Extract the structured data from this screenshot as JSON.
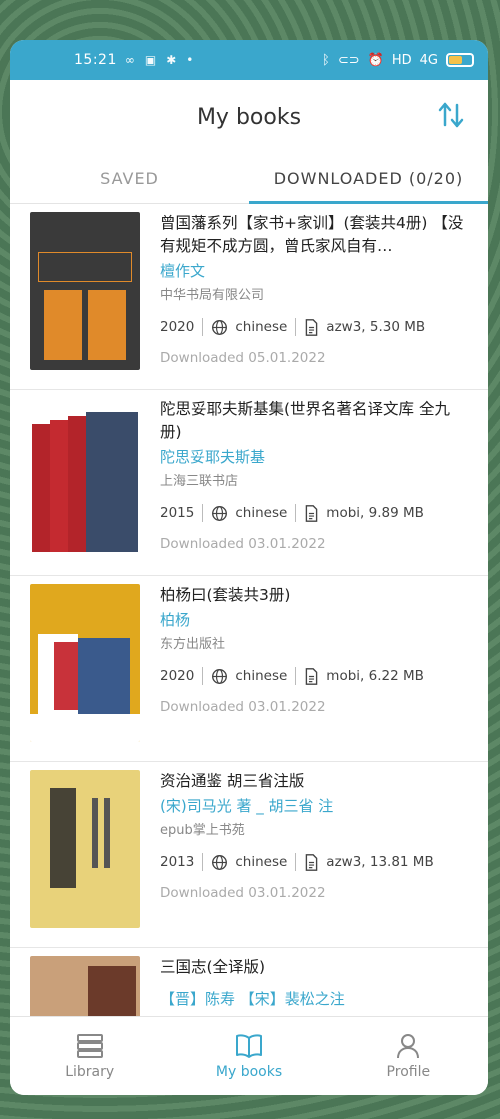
{
  "status": {
    "time": "15:21",
    "network": "4G"
  },
  "header": {
    "title": "My books"
  },
  "tabs": [
    {
      "label": "SAVED"
    },
    {
      "label": "DOWNLOADED (0/20)"
    }
  ],
  "books": [
    {
      "title": "曾国藩系列【家书+家训】(套装共4册) 【没有规矩不成方圆，曾氏家风自有…",
      "author": "檀作文",
      "publisher": "中华书局有限公司",
      "year": "2020",
      "language": "chinese",
      "file": "azw3, 5.30 MB",
      "downloaded": "Downloaded 05.01.2022",
      "cover_color": "#3a3a3a",
      "cover_accent": "#e08a2a"
    },
    {
      "title": "陀思妥耶夫斯基集(世界名著名译文库 全九册)",
      "author": "陀思妥耶夫斯基",
      "publisher": "上海三联书店",
      "year": "2015",
      "language": "chinese",
      "file": "mobi, 9.89 MB",
      "downloaded": "Downloaded 03.01.2022",
      "cover_color": "#b3242a",
      "cover_accent": "#3a4c6a"
    },
    {
      "title": "柏杨曰(套装共3册)",
      "author": "柏杨",
      "publisher": "东方出版社",
      "year": "2020",
      "language": "chinese",
      "file": "mobi, 6.22 MB",
      "downloaded": "Downloaded 03.01.2022",
      "cover_color": "#e0a81e",
      "cover_accent": "#3a5a8c"
    },
    {
      "title": "资治通鉴 胡三省注版",
      "author": "(宋)司马光 著 _ 胡三省 注",
      "publisher": "epub掌上书苑",
      "year": "2013",
      "language": "chinese",
      "file": "azw3, 13.81 MB",
      "downloaded": "Downloaded 03.01.2022",
      "cover_color": "#e8d27a",
      "cover_accent": "#2a2a2a"
    },
    {
      "title": "三国志(全译版)",
      "author": "【晋】陈寿 【宋】裴松之注",
      "publisher": "",
      "year": "",
      "language": "",
      "file": "",
      "downloaded": "",
      "cover_color": "#c9a07a",
      "cover_accent": "#6b3a2a"
    }
  ],
  "nav": [
    {
      "label": "Library"
    },
    {
      "label": "My books"
    },
    {
      "label": "Profile"
    }
  ],
  "colors": {
    "accent": "#3aa7cc"
  }
}
